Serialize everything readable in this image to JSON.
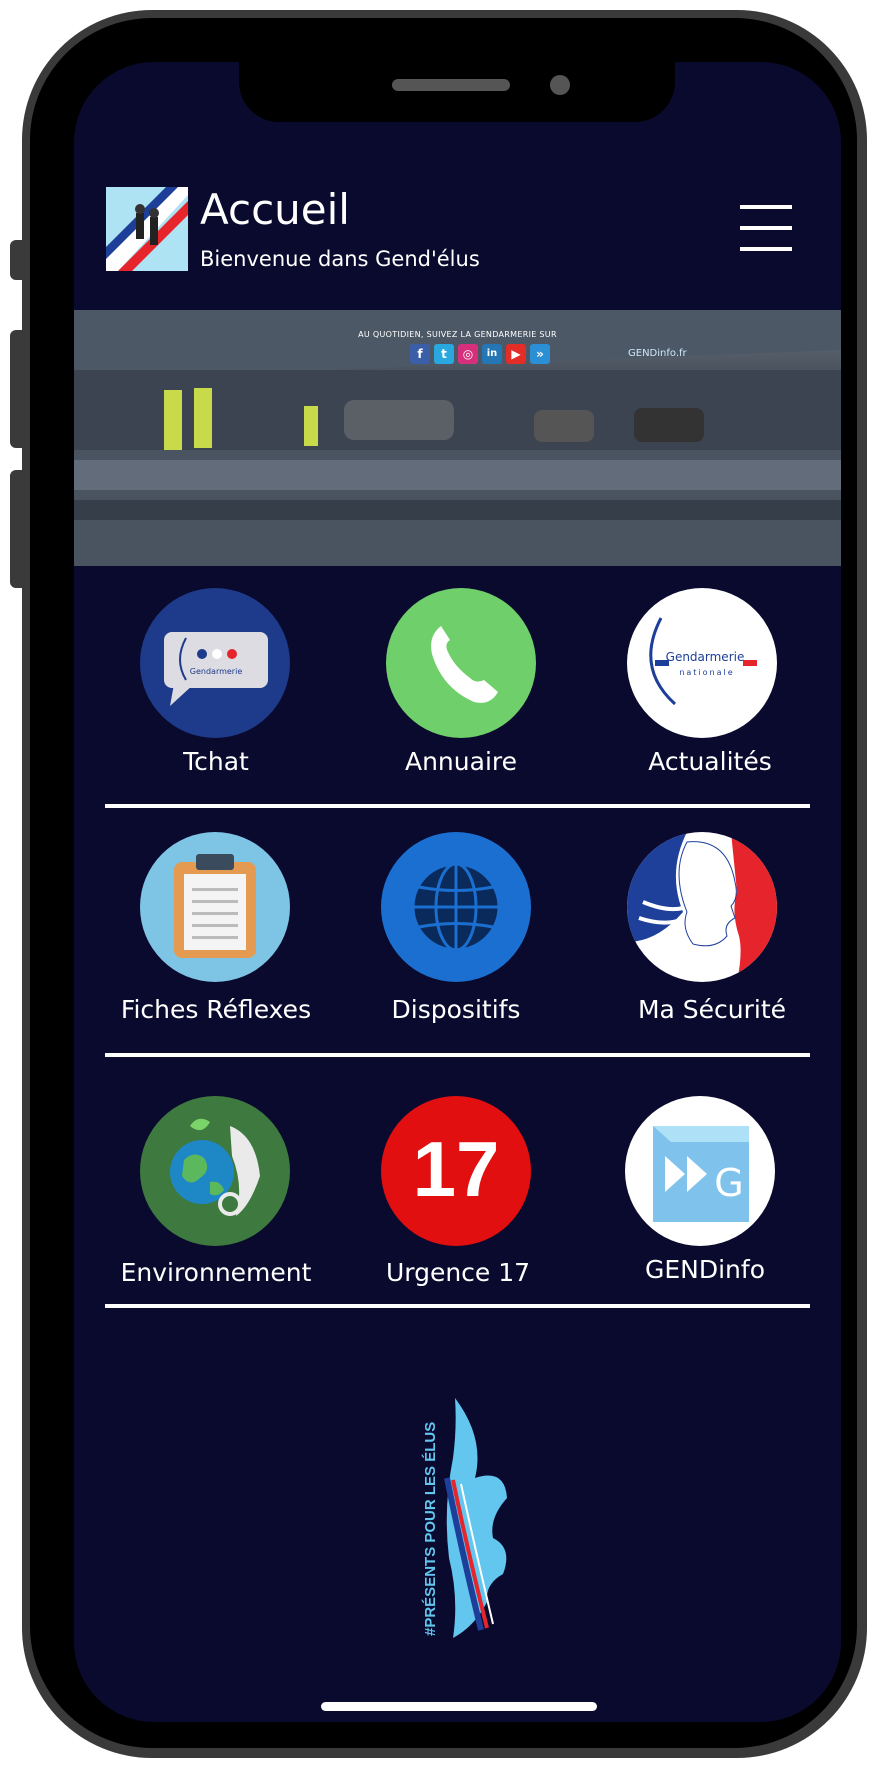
{
  "header": {
    "title": "Accueil",
    "subtitle": "Bienvenue dans Gend'élus",
    "menu_icon": "hamburger-menu-icon"
  },
  "banner": {
    "caption": "AU QUOTIDIEN, SUIVEZ LA GENDARMERIE SUR",
    "social_icons": [
      "facebook-icon",
      "twitter-icon",
      "instagram-icon",
      "linkedin-icon",
      "youtube-icon",
      "gendinfo-icon"
    ],
    "gendinfo_text": "GENDinfo.fr"
  },
  "tiles": [
    {
      "label": "Tchat",
      "icon": "chat-bubble-icon"
    },
    {
      "label": "Annuaire",
      "icon": "phone-icon"
    },
    {
      "label": "Actualités",
      "icon": "gendarmerie-nationale-logo",
      "logo_text": "Gendarmerie",
      "logo_sub": "nationale"
    },
    {
      "label": "Fiches Réflexes",
      "icon": "clipboard-icon"
    },
    {
      "label": "Dispositifs",
      "icon": "globe-icon"
    },
    {
      "label": "Ma Sécurité",
      "icon": "marianne-icon"
    },
    {
      "label": "Environnement",
      "icon": "environment-earth-icon"
    },
    {
      "label": "Urgence 17",
      "icon": "emergency-17-icon",
      "number": "17"
    },
    {
      "label": "GENDinfo",
      "icon": "gendinfo-logo-icon"
    }
  ],
  "chat_bubble_text": "Gendarmerie",
  "gendinfo_letter": "G",
  "footer": {
    "slogan": "#PRÉSENTS POUR LES ÉLUS",
    "emblem": "gendarmerie-flame-emblem"
  },
  "colors": {
    "background": "#0a0a2e",
    "divider": "#ffffff",
    "urgence": "#e10f0f",
    "annuaire": "#6fcf6a",
    "dispositifs": "#1a6fd0"
  }
}
